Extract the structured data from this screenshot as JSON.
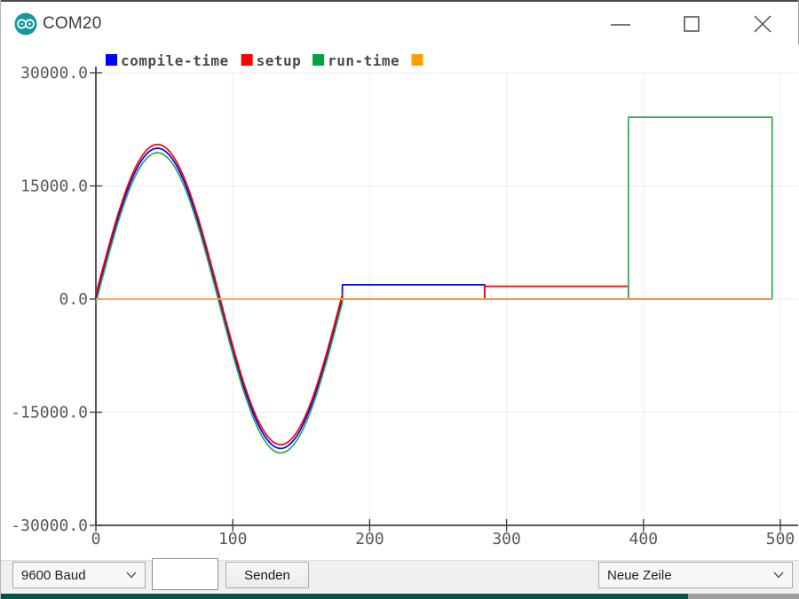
{
  "window": {
    "title": "COM20",
    "controls": {
      "minimize": "minimize",
      "maximize": "maximize",
      "close": "close"
    }
  },
  "chart_data": {
    "type": "line",
    "title": "",
    "xlabel": "",
    "ylabel": "",
    "xlim": [
      0,
      500
    ],
    "ylim": [
      -30000,
      30000
    ],
    "x_ticks": [
      0,
      100,
      200,
      300,
      400,
      500
    ],
    "y_ticks": [
      -30000,
      -15000,
      0,
      15000,
      30000
    ],
    "y_tick_format": [
      "-30000.0",
      "-15000.0",
      "0.0",
      "15000.0",
      "30000.0"
    ],
    "grid": true,
    "legend_position": "top-left",
    "legend": [
      {
        "label": "compile-time",
        "color": "#0000ff"
      },
      {
        "label": "setup",
        "color": "#ff0000"
      },
      {
        "label": "run-time",
        "color": "#00a33d"
      },
      {
        "label": "",
        "color": "#ffa000"
      }
    ],
    "series": [
      {
        "name": "compile-time",
        "color": "#0000ff",
        "segments": [
          {
            "type": "sine",
            "x0": 0,
            "x1": 180,
            "period": 180,
            "amplitude": 19900,
            "offset": 100
          },
          {
            "type": "step",
            "x0": 180,
            "x1": 284,
            "value": 1900
          },
          {
            "type": "step",
            "x0": 284,
            "x1": 494,
            "value": 0
          }
        ]
      },
      {
        "name": "setup",
        "color": "#ff0000",
        "segments": [
          {
            "type": "sine",
            "x0": 0,
            "x1": 180,
            "period": 180,
            "amplitude": 19900,
            "offset": 600
          },
          {
            "type": "step",
            "x0": 180,
            "x1": 284,
            "value": 0
          },
          {
            "type": "step",
            "x0": 284,
            "x1": 389,
            "value": 1700
          },
          {
            "type": "step",
            "x0": 389,
            "x1": 494,
            "value": 0
          }
        ]
      },
      {
        "name": "run-time",
        "color": "#30a64e",
        "segments": [
          {
            "type": "sine",
            "x0": 0,
            "x1": 180,
            "period": 180,
            "amplitude": 19900,
            "offset": -500
          },
          {
            "type": "step",
            "x0": 180,
            "x1": 389,
            "value": 0
          },
          {
            "type": "step",
            "x0": 389,
            "x1": 494,
            "value": 24100
          },
          {
            "type": "step",
            "x0": 494,
            "x1": 494,
            "value": 0
          }
        ]
      },
      {
        "name": "",
        "color": "#ffa055",
        "segments": [
          {
            "type": "step",
            "x0": 0,
            "x1": 494,
            "value": 0
          }
        ]
      }
    ]
  },
  "serial_controls": {
    "baud_selector": {
      "value": "9600 Baud"
    },
    "message_input": {
      "value": ""
    },
    "send_button": "Senden",
    "line_ending_selector": {
      "value": "Neue Zeile"
    }
  }
}
